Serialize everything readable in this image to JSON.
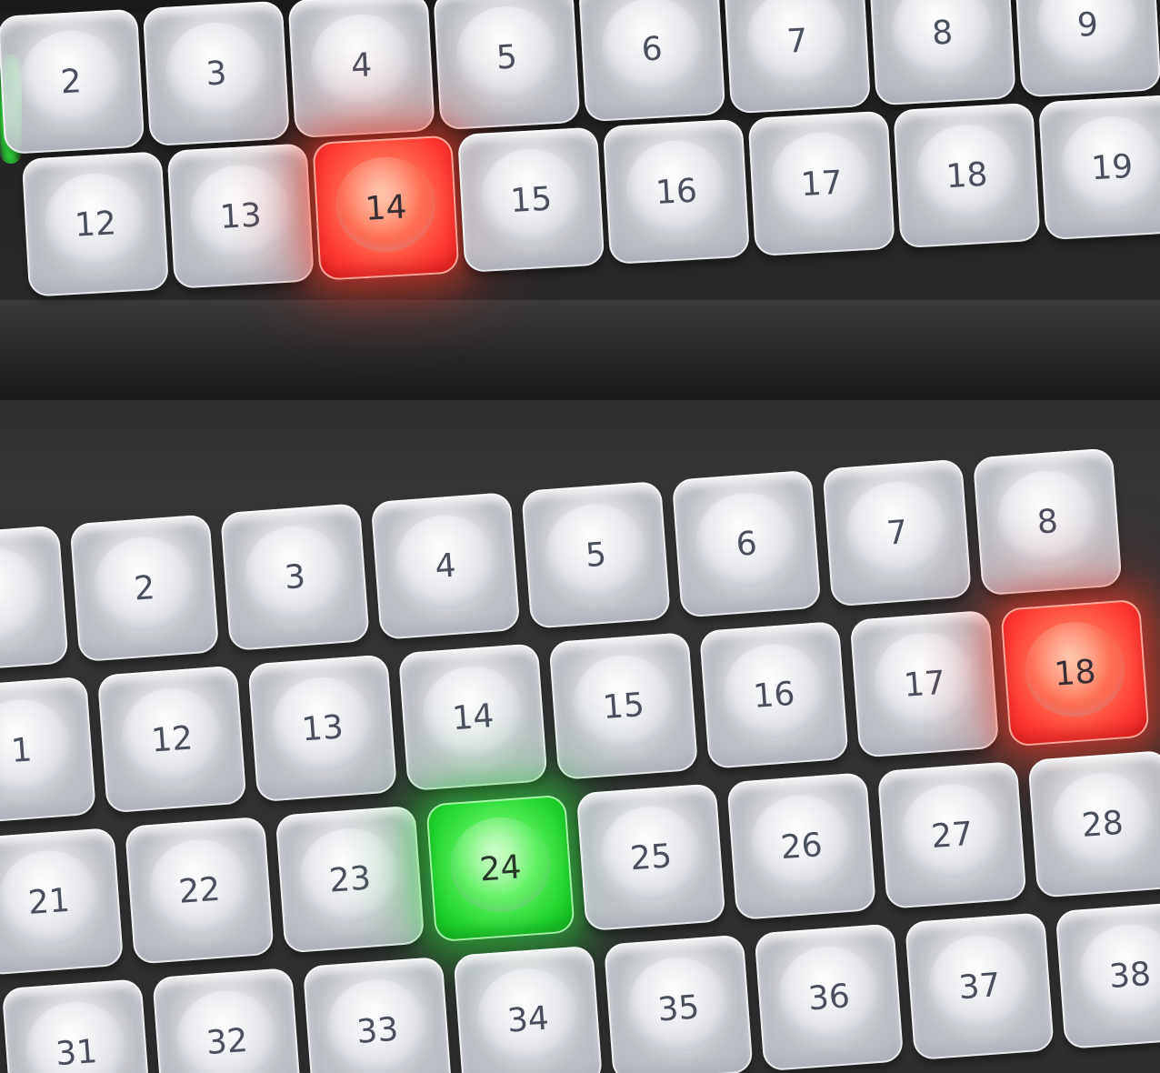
{
  "upper_panel": {
    "row1": [
      {
        "label": "2",
        "light": "none"
      },
      {
        "label": "3",
        "light": "none"
      },
      {
        "label": "4",
        "light": "none"
      },
      {
        "label": "5",
        "light": "none"
      },
      {
        "label": "6",
        "light": "none"
      },
      {
        "label": "7",
        "light": "none"
      },
      {
        "label": "8",
        "light": "none"
      },
      {
        "label": "9",
        "light": "none"
      }
    ],
    "row2": [
      {
        "label": "12",
        "light": "none"
      },
      {
        "label": "13",
        "light": "none"
      },
      {
        "label": "14",
        "light": "red"
      },
      {
        "label": "15",
        "light": "none"
      },
      {
        "label": "16",
        "light": "none"
      },
      {
        "label": "17",
        "light": "none"
      },
      {
        "label": "18",
        "light": "none"
      },
      {
        "label": "19",
        "light": "none"
      }
    ]
  },
  "lower_panel": {
    "row1": [
      {
        "label": "",
        "light": "none"
      },
      {
        "label": "2",
        "light": "none"
      },
      {
        "label": "3",
        "light": "none"
      },
      {
        "label": "4",
        "light": "none"
      },
      {
        "label": "5",
        "light": "none"
      },
      {
        "label": "6",
        "light": "none"
      },
      {
        "label": "7",
        "light": "none"
      },
      {
        "label": "8",
        "light": "none"
      }
    ],
    "row2": [
      {
        "label": "1",
        "light": "none"
      },
      {
        "label": "12",
        "light": "none"
      },
      {
        "label": "13",
        "light": "none"
      },
      {
        "label": "14",
        "light": "none"
      },
      {
        "label": "15",
        "light": "none"
      },
      {
        "label": "16",
        "light": "none"
      },
      {
        "label": "17",
        "light": "none"
      },
      {
        "label": "18",
        "light": "red"
      }
    ],
    "row3": [
      {
        "label": "21",
        "light": "none"
      },
      {
        "label": "22",
        "light": "none"
      },
      {
        "label": "23",
        "light": "none"
      },
      {
        "label": "24",
        "light": "green"
      },
      {
        "label": "25",
        "light": "none"
      },
      {
        "label": "26",
        "light": "none"
      },
      {
        "label": "27",
        "light": "none"
      },
      {
        "label": "28",
        "light": "none"
      }
    ],
    "row4": [
      {
        "label": "31",
        "light": "none"
      },
      {
        "label": "32",
        "light": "none"
      },
      {
        "label": "33",
        "light": "none"
      },
      {
        "label": "34",
        "light": "none"
      },
      {
        "label": "35",
        "light": "none"
      },
      {
        "label": "36",
        "light": "none"
      },
      {
        "label": "37",
        "light": "none"
      },
      {
        "label": "38",
        "light": "none"
      }
    ]
  },
  "colors": {
    "red_light": "#ff3b33",
    "green_light": "#22d62e",
    "key_label": "#4a4f5e",
    "housing": "#2c2c2d"
  }
}
